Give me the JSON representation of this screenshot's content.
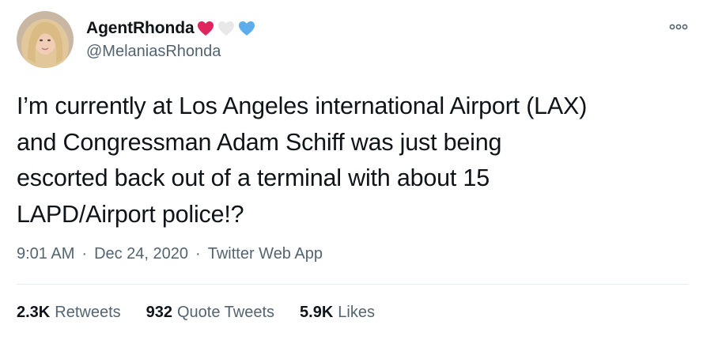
{
  "author": {
    "display_name": "AgentRhonda",
    "handle": "@MelaniasRhonda",
    "emoji_icons": [
      "red-heart-icon",
      "white-heart-icon",
      "blue-heart-icon"
    ]
  },
  "tweet": {
    "text": "I’m currently at Los Angeles international Airport (LAX)\nand Congressman Adam Schiff was just being\nescorted back out of a terminal with about 15\nLAPD/Airport police!?"
  },
  "meta": {
    "time": "9:01 AM",
    "separator": "·",
    "date": "Dec 24, 2020",
    "source": "Twitter Web App"
  },
  "stats": {
    "retweets": {
      "count": "2.3K",
      "label": "Retweets"
    },
    "quote_tweets": {
      "count": "932",
      "label": "Quote Tweets"
    },
    "likes": {
      "count": "5.9K",
      "label": "Likes"
    }
  },
  "colors": {
    "text_primary": "#0f1419",
    "text_secondary": "#536471",
    "divider": "#e6ecf0",
    "heart_red": "#e0245e",
    "heart_white": "#e8e8e8",
    "heart_blue": "#5dadec"
  }
}
